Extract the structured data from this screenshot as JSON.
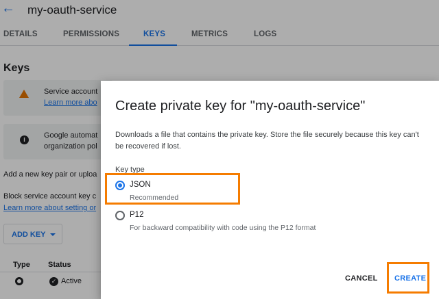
{
  "header": {
    "back_icon": "arrow-left-icon",
    "title": "my-oauth-service"
  },
  "tabs": [
    {
      "label": "DETAILS",
      "active": false
    },
    {
      "label": "PERMISSIONS",
      "active": false
    },
    {
      "label": "KEYS",
      "active": true
    },
    {
      "label": "METRICS",
      "active": false
    },
    {
      "label": "LOGS",
      "active": false
    }
  ],
  "keys_section": {
    "heading": "Keys",
    "notice_warning": {
      "icon": "warning-icon",
      "text": "Service account",
      "link": "Learn more abo"
    },
    "notice_info": {
      "icon": "info-icon",
      "line1": "Google automat",
      "line2": "organization pol"
    },
    "add_pair_text": "Add a new key pair or uploa",
    "block_text": "Block service account key c",
    "learn_link": "Learn more about setting or",
    "add_key_label": "ADD KEY",
    "table": {
      "columns": [
        "Type",
        "Status"
      ],
      "rows": [
        {
          "type_icon": "gear-icon",
          "status_icon": "check-circle-icon",
          "status": "Active"
        }
      ]
    }
  },
  "dialog": {
    "title": "Create private key for \"my-oauth-service\"",
    "description": "Downloads a file that contains the private key. Store the file securely because this key can't be recovered if lost.",
    "key_type_label": "Key type",
    "options": [
      {
        "label": "JSON",
        "sublabel": "Recommended",
        "selected": true
      },
      {
        "label": "P12",
        "sublabel": "For backward compatibility with code using the P12 format",
        "selected": false
      }
    ],
    "cancel_label": "CANCEL",
    "create_label": "CREATE"
  },
  "colors": {
    "accent": "#1a73e8",
    "highlight": "#f57c00",
    "warning": "#e37400"
  }
}
